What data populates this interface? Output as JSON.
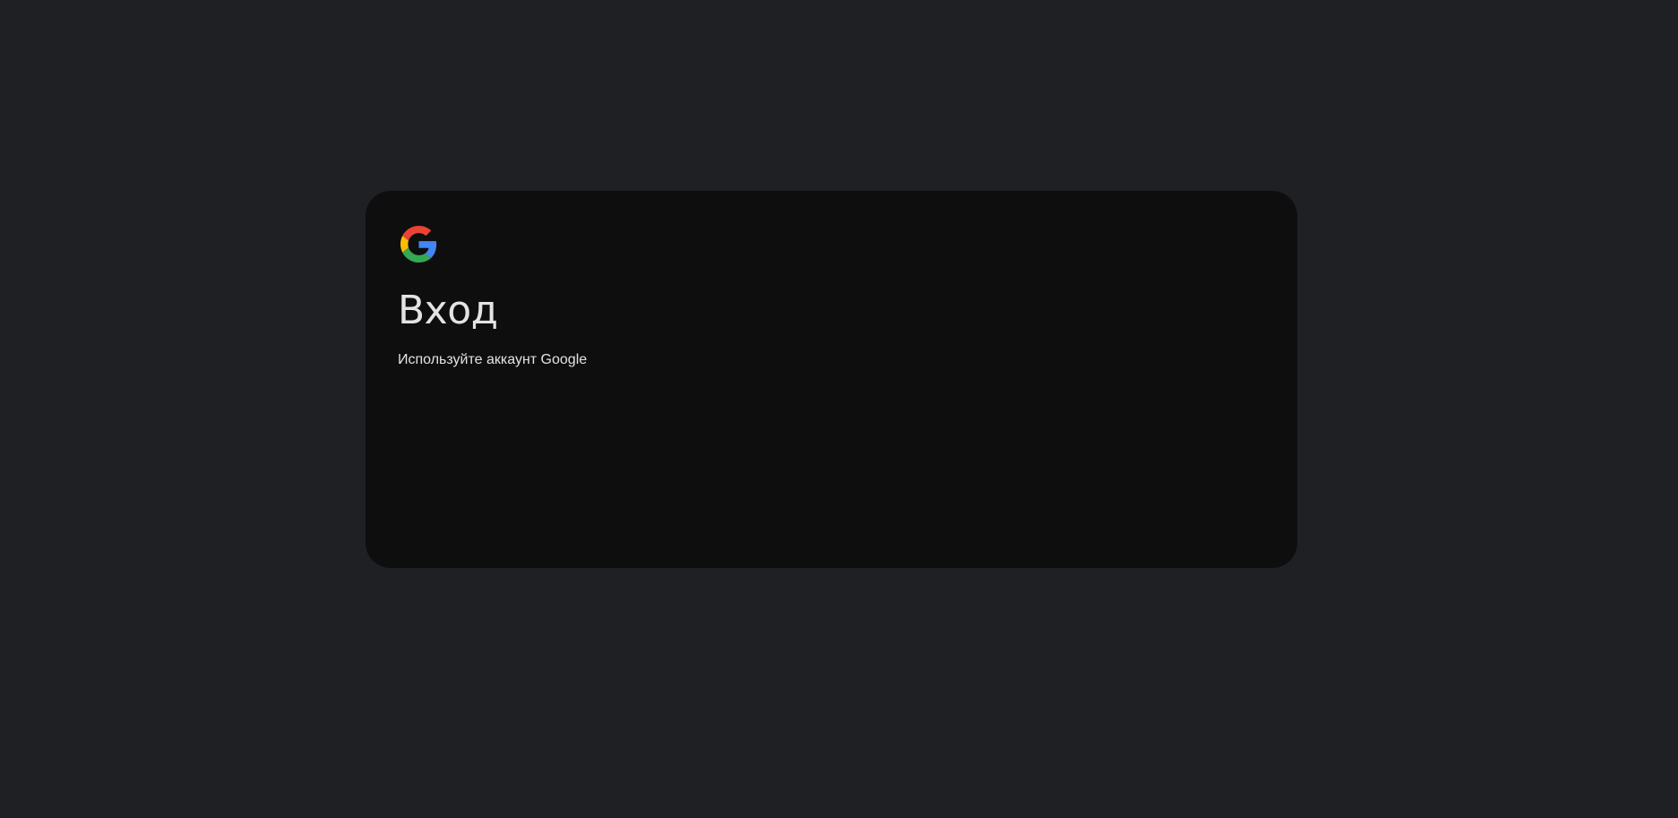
{
  "signin": {
    "logo_icon": "google-g-logo",
    "title": "Вход",
    "subtitle": "Используйте аккаунт Google"
  },
  "colors": {
    "page_background": "#1f2023",
    "card_background": "#0e0e0e",
    "text": "#e3e3e3",
    "google_blue": "#4285F4",
    "google_green": "#34A853",
    "google_yellow": "#FBBC05",
    "google_red": "#EA4335"
  }
}
